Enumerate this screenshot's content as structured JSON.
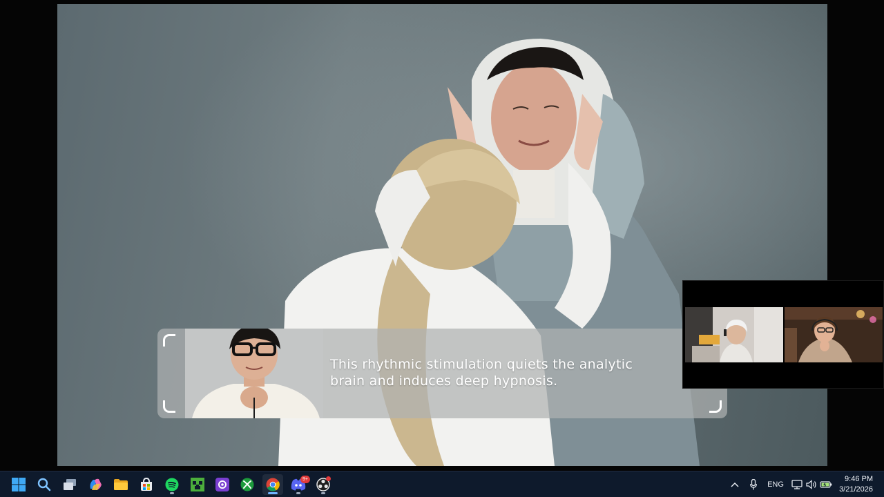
{
  "caption": {
    "text": "This rhythmic stimulation quiets the analytic\nbrain and induces deep hypnosis."
  },
  "taskbar": {
    "apps": [
      {
        "name": "start-menu-button",
        "icon": "windows-logo-icon"
      },
      {
        "name": "search-button",
        "icon": "search-icon"
      },
      {
        "name": "task-view-button",
        "icon": "task-view-icon"
      },
      {
        "name": "copilot-button",
        "icon": "copilot-icon"
      },
      {
        "name": "file-explorer-button",
        "icon": "folder-icon"
      },
      {
        "name": "microsoft-store-button",
        "icon": "store-icon"
      },
      {
        "name": "spotify-button",
        "icon": "spotify-icon"
      },
      {
        "name": "minecraft-button",
        "icon": "minecraft-icon"
      },
      {
        "name": "app-button",
        "icon": "camera-app-icon"
      },
      {
        "name": "xbox-button",
        "icon": "xbox-icon"
      },
      {
        "name": "chrome-button",
        "icon": "chrome-icon",
        "active": true
      },
      {
        "name": "discord-button",
        "icon": "discord-icon",
        "badge": "9+"
      },
      {
        "name": "obs-button",
        "icon": "obs-icon",
        "dot": true
      }
    ],
    "tray": {
      "language": "ENG",
      "time": "9:46 PM",
      "date": "3/21/2026"
    }
  },
  "colors": {
    "taskbar_bg": "#0e1a2c",
    "active_indicator": "#6fb4ff",
    "badge": "#e23b3b"
  }
}
